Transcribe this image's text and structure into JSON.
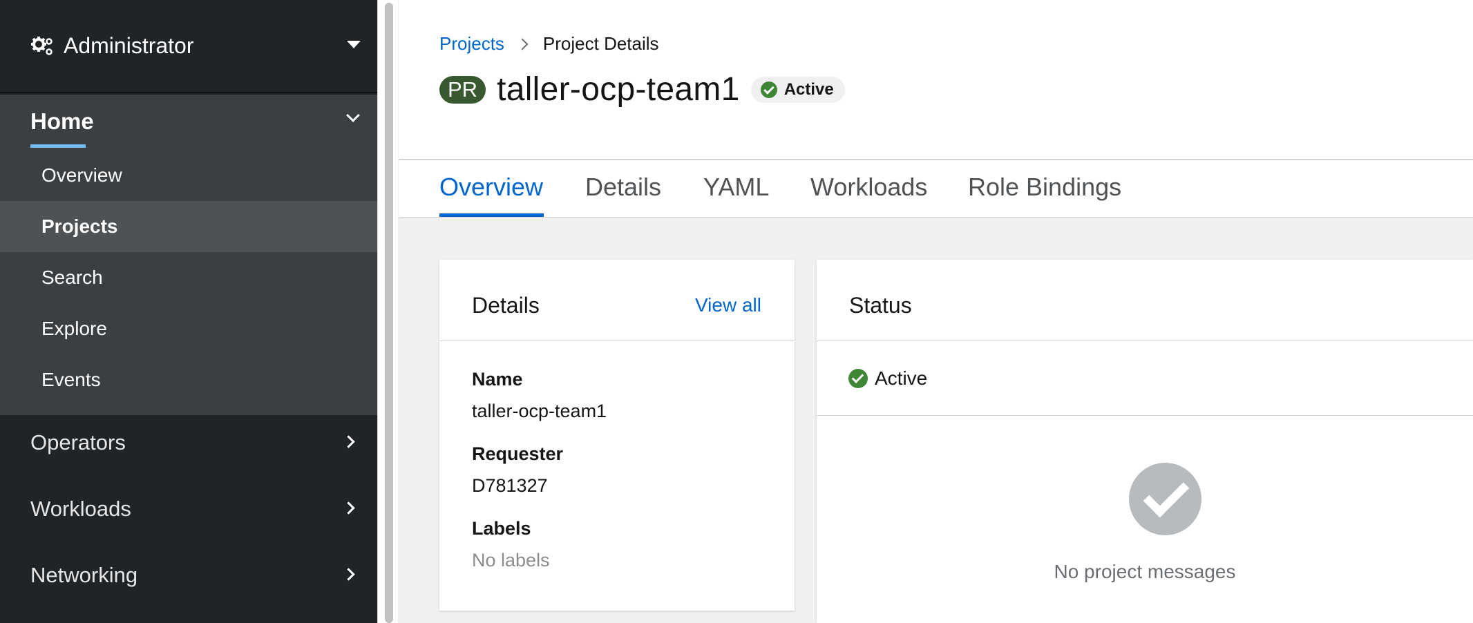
{
  "sidebar": {
    "perspective": "Administrator",
    "home": {
      "label": "Home",
      "items": [
        "Overview",
        "Projects",
        "Search",
        "Explore",
        "Events"
      ],
      "active_item": "Projects"
    },
    "sections": [
      "Operators",
      "Workloads",
      "Networking"
    ]
  },
  "breadcrumb": {
    "parent": "Projects",
    "current": "Project Details"
  },
  "header": {
    "resource_badge": "PR",
    "title": "taller-ocp-team1",
    "status": "Active"
  },
  "tabs": [
    "Overview",
    "Details",
    "YAML",
    "Workloads",
    "Role Bindings"
  ],
  "active_tab": "Overview",
  "details_card": {
    "title": "Details",
    "view_all": "View all",
    "fields": [
      {
        "term": "Name",
        "value": "taller-ocp-team1"
      },
      {
        "term": "Requester",
        "value": "D781327"
      },
      {
        "term": "Labels",
        "value": "No labels"
      }
    ]
  },
  "status_card": {
    "title": "Status",
    "status": "Active",
    "empty_message": "No project messages"
  },
  "colors": {
    "sidebar_bg": "#212427",
    "sidebar_section_bg": "#3c3f42",
    "sidebar_active_bg": "#4f5255",
    "link": "#0066cc",
    "success": "#3e8635",
    "resource_badge": "#38582f"
  }
}
